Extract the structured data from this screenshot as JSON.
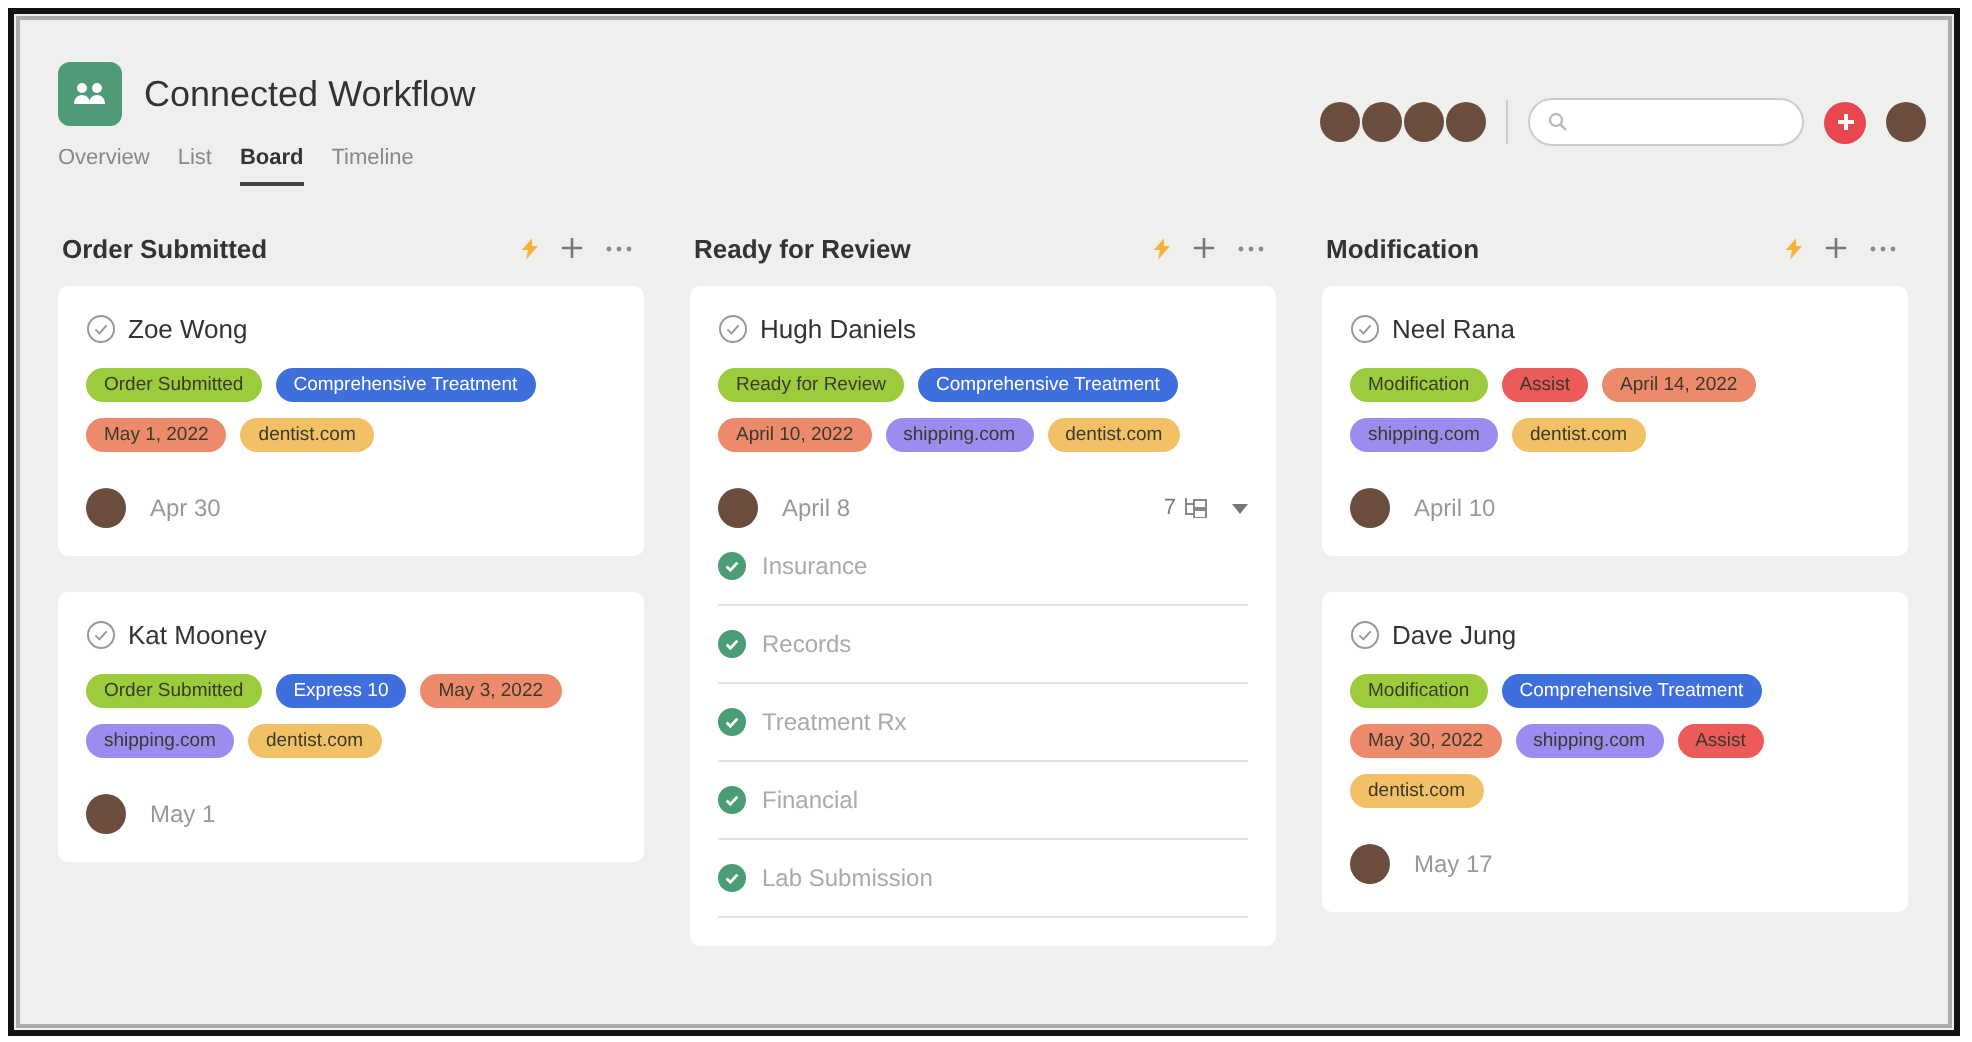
{
  "project": {
    "title": "Connected Workflow"
  },
  "tabs": [
    {
      "label": "Overview",
      "selected": false
    },
    {
      "label": "List",
      "selected": false
    },
    {
      "label": "Board",
      "selected": true
    },
    {
      "label": "Timeline",
      "selected": false
    }
  ],
  "columns": [
    {
      "title": "Order Submitted",
      "cards": [
        {
          "name": "Zoe Wong",
          "completed": false,
          "tags": [
            {
              "label": "Order Submitted",
              "color": "#9ccc3c"
            },
            {
              "label": "Comprehensive Treatment",
              "color": "#3f6fdc"
            },
            {
              "label": "May 1, 2022",
              "color": "#ee8a6c"
            },
            {
              "label": "dentist.com",
              "color": "#f2c065"
            }
          ],
          "due": "Apr 30"
        },
        {
          "name": "Kat Mooney",
          "completed": false,
          "tags": [
            {
              "label": "Order Submitted",
              "color": "#9ccc3c"
            },
            {
              "label": "Express 10",
              "color": "#3f6fdc"
            },
            {
              "label": "May 3, 2022",
              "color": "#ee8a6c"
            },
            {
              "label": "shipping.com",
              "color": "#9b8df0"
            },
            {
              "label": "dentist.com",
              "color": "#f2c065"
            }
          ],
          "due": "May 1"
        }
      ]
    },
    {
      "title": "Ready for Review",
      "cards": [
        {
          "name": "Hugh Daniels",
          "completed": false,
          "tags": [
            {
              "label": "Ready for Review",
              "color": "#9ccc3c"
            },
            {
              "label": "Comprehensive Treatment",
              "color": "#3f6fdc"
            },
            {
              "label": "April 10, 2022",
              "color": "#ee8a6c"
            },
            {
              "label": "shipping.com",
              "color": "#9b8df0"
            },
            {
              "label": "dentist.com",
              "color": "#f2c065"
            }
          ],
          "due": "April 8",
          "subtask_count": "7",
          "subtasks": [
            {
              "label": "Insurance",
              "checked": true
            },
            {
              "label": "Records",
              "checked": true
            },
            {
              "label": "Treatment Rx",
              "checked": true
            },
            {
              "label": "Financial",
              "checked": true
            },
            {
              "label": "Lab Submission",
              "checked": true
            }
          ]
        }
      ]
    },
    {
      "title": "Modification",
      "cards": [
        {
          "name": "Neel Rana",
          "completed": false,
          "tags": [
            {
              "label": "Modification",
              "color": "#9ccc3c"
            },
            {
              "label": "Assist",
              "color": "#ec5a5a"
            },
            {
              "label": "April 14, 2022",
              "color": "#ee8a6c"
            },
            {
              "label": "shipping.com",
              "color": "#9b8df0"
            },
            {
              "label": "dentist.com",
              "color": "#f2c065"
            }
          ],
          "due": "April 10"
        },
        {
          "name": "Dave Jung",
          "completed": false,
          "tags": [
            {
              "label": "Modification",
              "color": "#9ccc3c"
            },
            {
              "label": "Comprehensive Treatment",
              "color": "#3f6fdc"
            },
            {
              "label": "May 30, 2022",
              "color": "#ee8a6c"
            },
            {
              "label": "shipping.com",
              "color": "#9b8df0"
            },
            {
              "label": "Assist",
              "color": "#ec5a5a"
            },
            {
              "label": "dentist.com",
              "color": "#f2c065"
            }
          ],
          "due": "May 17"
        }
      ]
    }
  ]
}
